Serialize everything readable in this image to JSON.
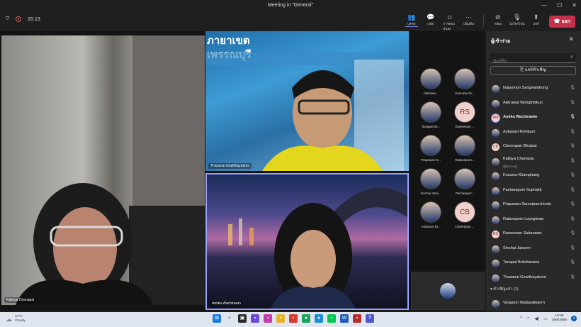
{
  "window": {
    "title": "Meeting in \"General\""
  },
  "toolbar": {
    "timer": "20:13",
    "buttons": [
      {
        "label": "บุคคล",
        "icon": "people-icon"
      },
      {
        "label": "แชท",
        "icon": "chat-icon"
      },
      {
        "label": "การตอบสนอง",
        "icon": "reactions-icon"
      },
      {
        "label": "เพิ่มเติม",
        "icon": "more-icon"
      },
      {
        "label": "กล้อง",
        "icon": "camera-icon"
      },
      {
        "label": "ไมโครโฟน",
        "icon": "mic-icon"
      },
      {
        "label": "แชร์",
        "icon": "share-icon"
      }
    ],
    "leave_label": "ออก"
  },
  "stage": {
    "tiles": [
      {
        "name": "Kallaya Chanapai"
      },
      {
        "name": "Thasanai Gowithayakorn",
        "sign_text": "ภายาเขต\nเพรรณบุรี"
      },
      {
        "name": "Amika Wachirawin"
      }
    ]
  },
  "gallery": {
    "items": [
      {
        "label": "Akkrawa...",
        "initials": ""
      },
      {
        "label": "Kusuma Kh...",
        "initials": ""
      },
      {
        "label": "Tanapat Bri...",
        "initials": ""
      },
      {
        "label": "Raweewan ...",
        "initials": "RS"
      },
      {
        "label": "Prapawan S...",
        "initials": ""
      },
      {
        "label": "Ratanaporn...",
        "initials": ""
      },
      {
        "label": "Sinchai Jans...",
        "initials": ""
      },
      {
        "label": "Pacharapor...",
        "initials": ""
      },
      {
        "label": "Auttasart Ni...",
        "initials": ""
      },
      {
        "label": "Cheerapan ...",
        "initials": "CB"
      }
    ]
  },
  "panel": {
    "title": "ผู้เข้าร่วม",
    "search_placeholder": "พิมพ์ชื่อ",
    "share_label": "แชร์คำเชิญ",
    "participants": [
      {
        "name": "Naluemon Sangwanthong",
        "initials": "",
        "mic": "off"
      },
      {
        "name": "Akkrawat Wongthitikun",
        "initials": "",
        "mic": "off"
      },
      {
        "name": "Amika Wachirawin",
        "initials": "AW",
        "mic": "on"
      },
      {
        "name": "Auttasart Nimitpun",
        "initials": "",
        "mic": "off"
      },
      {
        "name": "Cheerapan Bhulpat",
        "initials": "CB",
        "mic": "off"
      },
      {
        "name": "Kallaya Chanapai",
        "initials": "",
        "mic": "off",
        "sub": "ผู้จัดประชุม"
      },
      {
        "name": "Kusuma Khamphang",
        "initials": "",
        "mic": "off"
      },
      {
        "name": "Pacharaporn Suphakit",
        "initials": "",
        "mic": "off"
      },
      {
        "name": "Prapawan Samutpaochinda",
        "initials": "",
        "mic": "off"
      },
      {
        "name": "Ratanaporn Loungkraw",
        "initials": "",
        "mic": "off"
      },
      {
        "name": "Raweewan Subanarat",
        "initials": "RS",
        "mic": "off"
      },
      {
        "name": "Sinchai Jansem",
        "initials": "",
        "mic": "off"
      },
      {
        "name": "Tanapat Brikshavana",
        "initials": "",
        "mic": "off"
      },
      {
        "name": "Thasanai Gowithayakorn",
        "initials": "",
        "mic": "off"
      }
    ],
    "group_label": "คำเชิญแล้ว (1)",
    "invited": {
      "name": "Varaporn Wattanakejorn"
    }
  },
  "taskbar": {
    "temperature": "31°C",
    "weather": "Cloudy",
    "time": "10:09",
    "date": "25/8/2565",
    "notif_count": "3"
  }
}
